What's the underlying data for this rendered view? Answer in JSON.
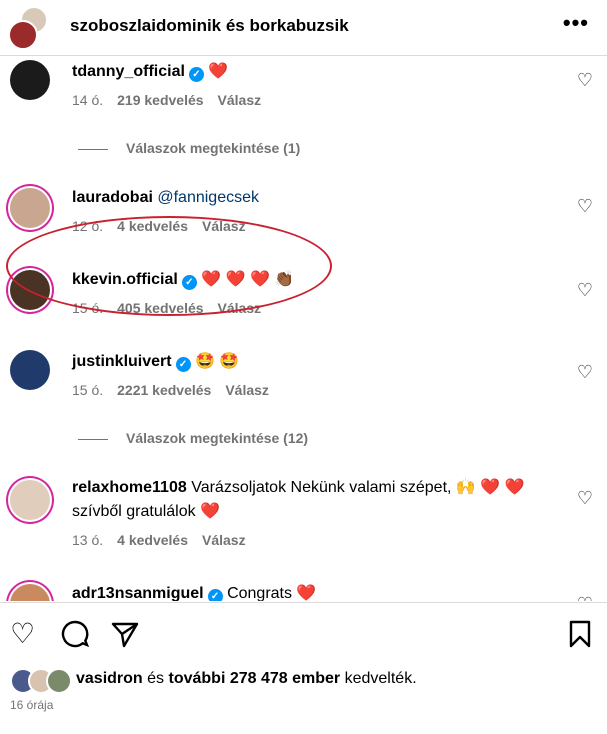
{
  "header": {
    "title": "szoboszlaidominik és borkabuzsik",
    "more": "•••"
  },
  "comments": [
    {
      "user": "tdanny_official",
      "text": "❤️",
      "time": "14 ó.",
      "likes": "219 kedvelés",
      "reply": "Válasz"
    },
    {
      "user": "lauradobai",
      "text": "@fannigecsek",
      "time": "12 ó.",
      "likes": "4 kedvelés",
      "reply": "Válasz"
    },
    {
      "user": "kkevin.official",
      "text": "❤️ ❤️ ❤️ 👏🏾",
      "time": "15 ó.",
      "likes": "405 kedvelés",
      "reply": "Válasz"
    },
    {
      "user": "justinkluivert",
      "text": "🤩 🤩",
      "time": "15 ó.",
      "likes": "2221 kedvelés",
      "reply": "Válasz"
    },
    {
      "user": "relaxhome1108",
      "text": "Varázsoljatok Nekünk valami szépet, 🙌 ❤️ ❤️ szívből gratulálok ❤️",
      "time": "13 ó.",
      "likes": "4 kedvelés",
      "reply": "Válasz"
    },
    {
      "user": "adr13nsanmiguel",
      "text": "Congrats ❤️"
    }
  ],
  "replies": [
    {
      "label": "Válaszok megtekintése (1)"
    },
    {
      "label": "Válaszok megtekintése (12)"
    }
  ],
  "likes": {
    "user": "vasidron",
    "middle": "és",
    "others": "további 278 478 ember",
    "suffix": "kedvelték."
  },
  "timestamp": "16 órája",
  "icons": [
    "heart-icon",
    "comment-icon",
    "share-icon",
    "bookmark-icon",
    "more-icon",
    "verified-icon"
  ],
  "colors": {
    "verified": "#0095f6",
    "annotation": "#c8212f",
    "mention": "#00376b"
  }
}
